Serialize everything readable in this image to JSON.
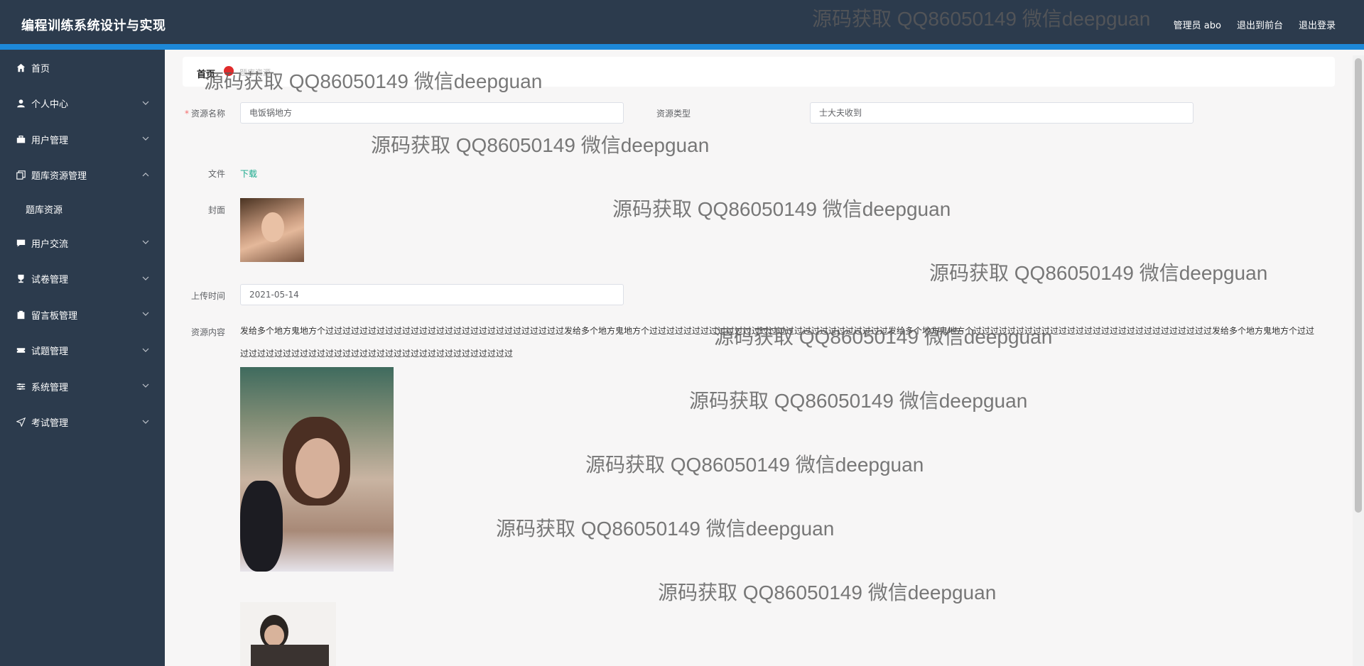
{
  "header": {
    "title": "编程训练系统设计与实现",
    "admin_label": "管理员 abo",
    "front_link": "退出到前台",
    "logout_link": "退出登录"
  },
  "sidebar": {
    "items": [
      {
        "label": "首页",
        "icon": "home-icon"
      },
      {
        "label": "个人中心",
        "icon": "user-icon"
      },
      {
        "label": "用户管理",
        "icon": "briefcase-icon"
      },
      {
        "label": "题库资源管理",
        "icon": "copy-icon",
        "expanded": true,
        "children": [
          "题库资源"
        ]
      },
      {
        "label": "用户交流",
        "icon": "chat-icon"
      },
      {
        "label": "试卷管理",
        "icon": "trophy-icon"
      },
      {
        "label": "留言板管理",
        "icon": "clipboard-icon"
      },
      {
        "label": "试题管理",
        "icon": "ticket-icon"
      },
      {
        "label": "系统管理",
        "icon": "sliders-icon"
      },
      {
        "label": "考试管理",
        "icon": "send-icon"
      }
    ]
  },
  "breadcrumb": {
    "home": "首页",
    "current": "题库资源"
  },
  "form": {
    "name_label": "资源名称",
    "name_value": "电饭锅地方",
    "type_label": "资源类型",
    "type_value": "士大夫收到",
    "file_label": "文件",
    "file_link": "下载",
    "cover_label": "封面",
    "time_label": "上传时间",
    "time_value": "2021-05-14",
    "content_label": "资源内容",
    "content_text": "发给多个地方鬼地方个过过过过过过过过过过过过过过过过过过过过过过过过过过过过发给多个地方鬼地方个过过过过过过过过过过过过过过过过过过过过过过过过过过过过发给多个地方鬼地方个过过过过过过过过过过过过过过过过过过过过过过过过过过过过发给多个地方鬼地方个过过过过过过过过过过过过过过过过过过过过过过过过过过过过过过过过过过"
  },
  "watermark": "源码获取 QQ86050149 微信deepguan",
  "colors": {
    "sidebar": "#2c3b4d",
    "accent": "#1d88d8",
    "link": "#19a98c",
    "required": "#f56c6c"
  }
}
